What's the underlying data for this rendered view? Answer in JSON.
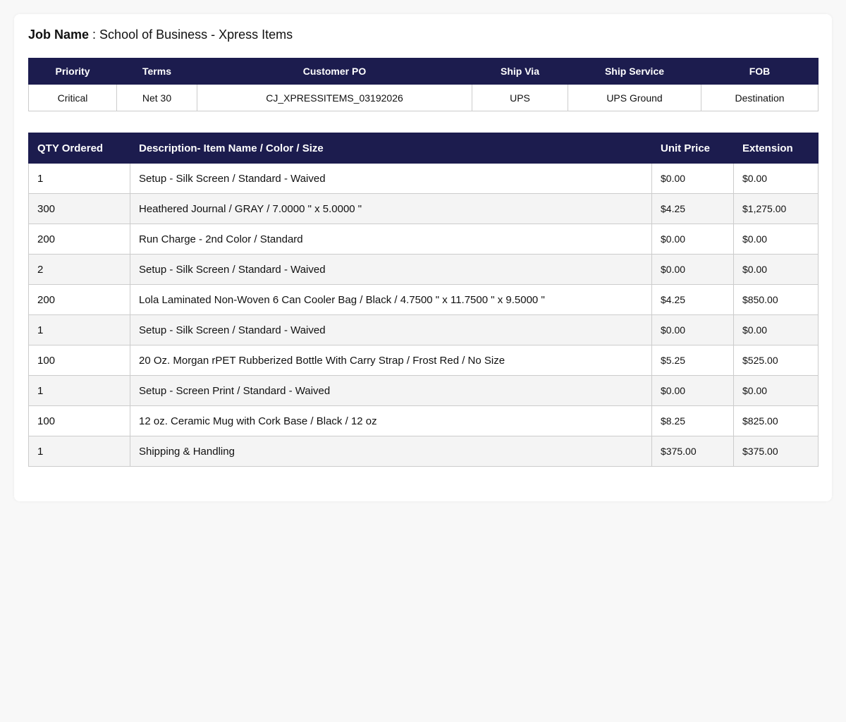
{
  "job": {
    "label": "Job Name",
    "separator": " : ",
    "value": "School of Business - Xpress Items"
  },
  "info": {
    "headers": [
      "Priority",
      "Terms",
      "Customer PO",
      "Ship Via",
      "Ship Service",
      "FOB"
    ],
    "values": [
      "Critical",
      "Net 30",
      "CJ_XPRESSITEMS_03192026",
      "UPS",
      "UPS Ground",
      "Destination"
    ]
  },
  "items": {
    "headers": [
      "QTY Ordered",
      "Description- Item Name / Color / Size",
      "Unit Price",
      "Extension"
    ],
    "rows": [
      {
        "qty": "1",
        "description": "Setup - Silk Screen / Standard - Waived",
        "unit_price": "$0.00",
        "extension": "$0.00"
      },
      {
        "qty": "300",
        "description": "Heathered Journal / GRAY / 7.0000 \" x 5.0000 \"",
        "unit_price": "$4.25",
        "extension": "$1,275.00"
      },
      {
        "qty": "200",
        "description": "Run Charge - 2nd Color / Standard",
        "unit_price": "$0.00",
        "extension": "$0.00"
      },
      {
        "qty": "2",
        "description": "Setup - Silk Screen / Standard - Waived",
        "unit_price": "$0.00",
        "extension": "$0.00"
      },
      {
        "qty": "200",
        "description": "Lola Laminated Non-Woven 6 Can Cooler Bag / Black / 4.7500 \" x 11.7500 \" x 9.5000 \"",
        "unit_price": "$4.25",
        "extension": "$850.00"
      },
      {
        "qty": "1",
        "description": "Setup - Silk Screen / Standard - Waived",
        "unit_price": "$0.00",
        "extension": "$0.00"
      },
      {
        "qty": "100",
        "description": "20 Oz. Morgan rPET Rubberized Bottle With Carry Strap / Frost Red / No Size",
        "unit_price": "$5.25",
        "extension": "$525.00"
      },
      {
        "qty": "1",
        "description": "Setup - Screen Print / Standard - Waived",
        "unit_price": "$0.00",
        "extension": "$0.00"
      },
      {
        "qty": "100",
        "description": "12 oz. Ceramic Mug with Cork Base / Black / 12 oz",
        "unit_price": "$8.25",
        "extension": "$825.00"
      },
      {
        "qty": "1",
        "description": "Shipping & Handling",
        "unit_price": "$375.00",
        "extension": "$375.00"
      }
    ]
  },
  "colors": {
    "header_bg": "#1c1c4e",
    "header_text": "#ffffff",
    "row_alt_bg": "#f4f4f4",
    "border": "#cccccc"
  }
}
